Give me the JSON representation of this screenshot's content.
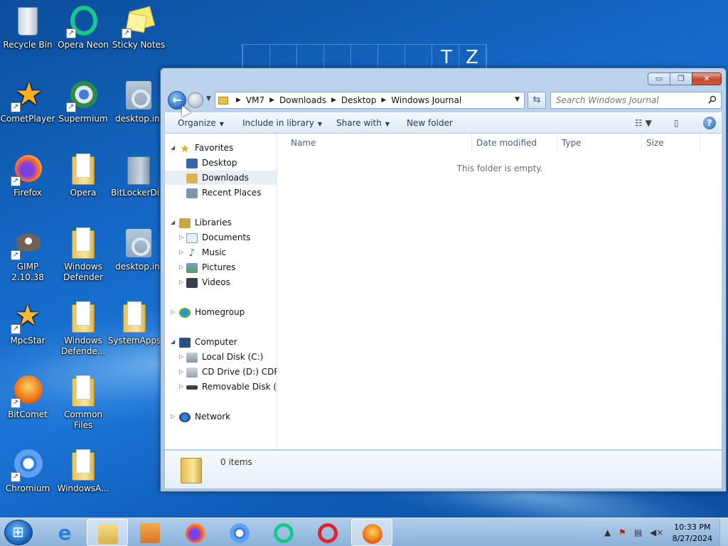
{
  "wallpaper": {
    "letters": [
      "T",
      "Z"
    ]
  },
  "desktop_icons": [
    {
      "label": "Recycle Bin",
      "icon": "recycle-bin-icon"
    },
    {
      "label": "Opera Neon",
      "icon": "opera-neon-icon"
    },
    {
      "label": "Sticky Notes",
      "icon": "sticky-notes-icon"
    },
    {
      "label": "CometPlayer",
      "icon": "cometplayer-icon"
    },
    {
      "label": "Supermium",
      "icon": "supermium-icon"
    },
    {
      "label": "desktop.ini",
      "icon": "ini-file-icon"
    },
    {
      "label": "Firefox",
      "icon": "firefox-icon"
    },
    {
      "label": "Opera",
      "icon": "folder-icon"
    },
    {
      "label": "BitLockerDi...",
      "icon": "folder-icon"
    },
    {
      "label": "GIMP 2.10.38",
      "icon": "gimp-icon"
    },
    {
      "label": "Windows Defender",
      "icon": "folder-icon"
    },
    {
      "label": "desktop.ini",
      "icon": "ini-file-icon"
    },
    {
      "label": "MpcStar",
      "icon": "mpcstar-icon"
    },
    {
      "label": "Windows Defende...",
      "icon": "folder-icon"
    },
    {
      "label": "SystemApps",
      "icon": "folder-icon"
    },
    {
      "label": "BitComet",
      "icon": "bitcomet-icon"
    },
    {
      "label": "Common Files",
      "icon": "folder-icon"
    },
    {
      "label": "Chromium",
      "icon": "chromium-icon"
    },
    {
      "label": "WindowsA...",
      "icon": "folder-icon"
    }
  ],
  "window": {
    "controls": {
      "minimize": "▭",
      "maximize": "❐",
      "close": "✕"
    },
    "address": {
      "crumbs": [
        "VM7",
        "Downloads",
        "Desktop",
        "Windows Journal"
      ]
    },
    "search": {
      "placeholder": "Search Windows Journal"
    },
    "commands": {
      "organize": "Organize",
      "include": "Include in library",
      "share": "Share with",
      "new_folder": "New folder"
    },
    "nav": {
      "favorites": "Favorites",
      "desktop": "Desktop",
      "downloads": "Downloads",
      "recent": "Recent Places",
      "libraries": "Libraries",
      "documents": "Documents",
      "music": "Music",
      "pictures": "Pictures",
      "videos": "Videos",
      "homegroup": "Homegroup",
      "computer": "Computer",
      "local_disk": "Local Disk (C:)",
      "cd_drive": "CD Drive (D:) CDROM",
      "removable": "Removable Disk (E:)",
      "network": "Network"
    },
    "columns": [
      "Name",
      "Date modified",
      "Type",
      "Size"
    ],
    "empty_message": "This folder is empty.",
    "details": {
      "count": "0 items"
    }
  },
  "taskbar": {
    "clock_time": "10:33 PM",
    "clock_date": "8/27/2024",
    "tray_arrow": "▲"
  },
  "colors": {
    "window_accent": "#bcd3ec",
    "close_button": "#c4472e",
    "taskbar": "#a6c2e0"
  }
}
